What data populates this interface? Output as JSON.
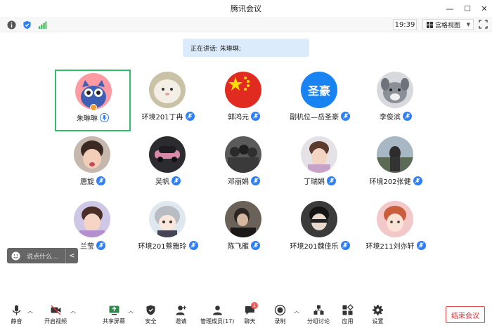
{
  "window": {
    "title": "腾讯会议",
    "minimize": "—",
    "maximize": "☐",
    "close": "✕"
  },
  "status_bar": {
    "time": "19:39",
    "view_label": "宫格视图"
  },
  "speaking": {
    "text": "正在讲话: 朱琳琳;"
  },
  "participants": [
    {
      "name": "朱琳琳",
      "avatar": "blue-cartoon-cat",
      "active": true,
      "mic": "speaking",
      "host": true
    },
    {
      "name": "环境201丁冉",
      "avatar": "white-fluffy-pet",
      "mic": "muted"
    },
    {
      "name": "郭鸿元",
      "avatar": "red-flag-with-stars",
      "mic": "muted"
    },
    {
      "name": "副机位—岳圣豪",
      "avatar": "text-avatar",
      "avatar_text": "圣豪",
      "mic": "muted"
    },
    {
      "name": "李俊滨",
      "avatar": "grey-cartoon-dog",
      "mic": "muted"
    },
    {
      "name": "唐旋",
      "avatar": "child-photo",
      "mic": "muted"
    },
    {
      "name": "吴帆",
      "avatar": "car-photo",
      "mic": "muted"
    },
    {
      "name": "邓丽娟",
      "avatar": "group-photo",
      "mic": "muted"
    },
    {
      "name": "丁瑞娟",
      "avatar": "child-photo",
      "mic": "muted"
    },
    {
      "name": "环境202张健",
      "avatar": "outdoor-photo",
      "mic": "muted"
    },
    {
      "name": "兰莹",
      "avatar": "child-photo",
      "mic": "muted"
    },
    {
      "name": "环境201蔡雅玲",
      "avatar": "anime-girl",
      "mic": "muted"
    },
    {
      "name": "陈飞雁",
      "avatar": "portrait-photo",
      "mic": "muted"
    },
    {
      "name": "环境201魏佳乐",
      "avatar": "portrait-photo",
      "mic": "muted"
    },
    {
      "name": "环境211刘亦轩",
      "avatar": "portrait-photo",
      "mic": "muted"
    }
  ],
  "chat_input": {
    "placeholder": "说点什么..."
  },
  "toolbar": {
    "mute": "静音",
    "video": "开启视频",
    "share": "共享屏幕",
    "security": "安全",
    "invite": "邀请",
    "members": "管理成员(17)",
    "chat": "聊天",
    "chat_badge": "1",
    "record": "录制",
    "breakout": "分组讨论",
    "apps": "应用",
    "settings": "设置",
    "end": "结束会议"
  },
  "colors": {
    "accent": "#2d7ff9",
    "active_border": "#2fbf6a",
    "end": "#d9373a",
    "banner": "#dcebfb"
  }
}
